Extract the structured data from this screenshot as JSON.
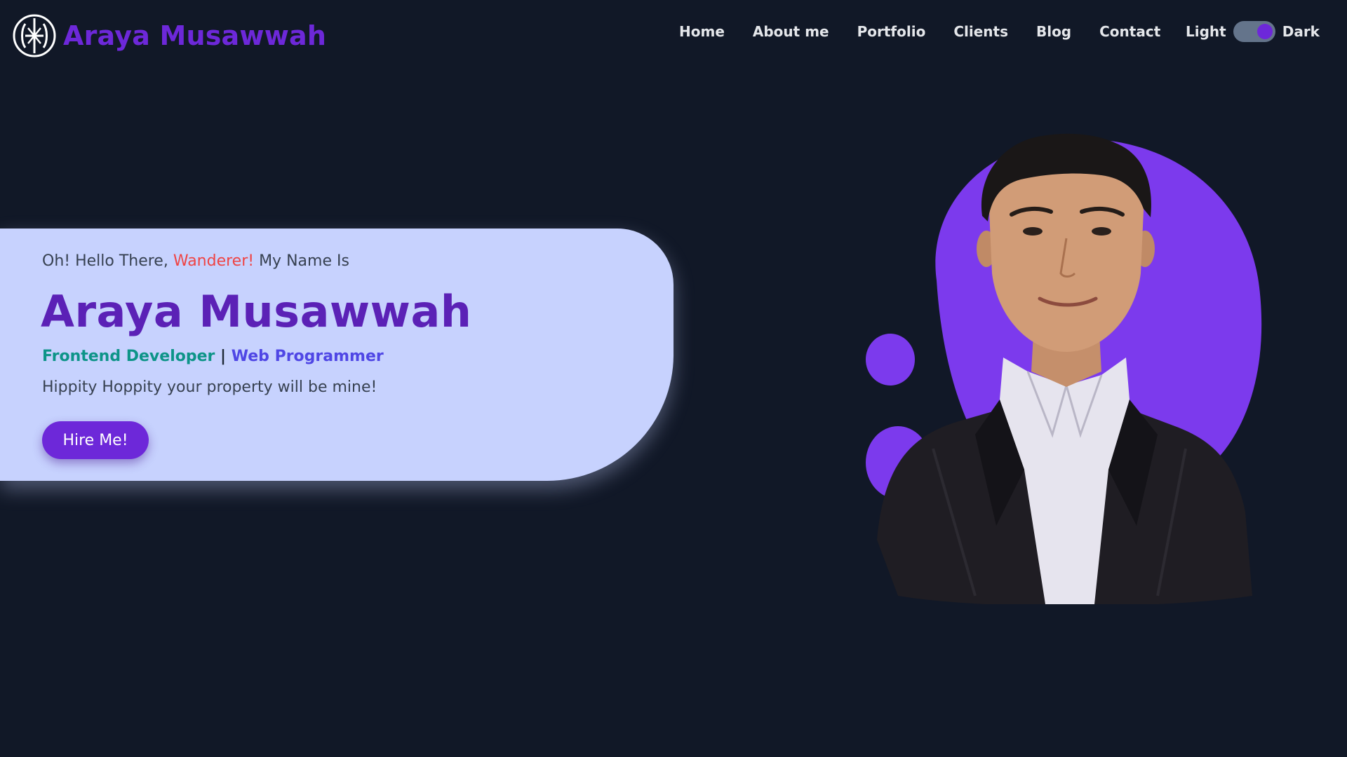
{
  "brand": {
    "logo_icon": "monogram-logo-icon",
    "name": "Araya Musawwah",
    "color": "#6d28d9"
  },
  "nav": {
    "links": [
      {
        "label": "Home"
      },
      {
        "label": "About me"
      },
      {
        "label": "Portfolio"
      },
      {
        "label": "Clients"
      },
      {
        "label": "Blog"
      },
      {
        "label": "Contact"
      }
    ]
  },
  "theme_toggle": {
    "light_label": "Light",
    "dark_label": "Dark",
    "state": "dark"
  },
  "hero": {
    "greeting_prefix": "Oh! Hello There,",
    "greeting_accent": "Wanderer!",
    "greeting_suffix": "My Name Is",
    "name": "Araya Musawwah",
    "role_1": "Frontend Developer",
    "role_separator": "|",
    "role_2": "Web Programmer",
    "tagline": "Hippity Hoppity your property will be mine!",
    "cta_label": "Hire Me!"
  },
  "portrait": {
    "description_icon": "profile-photo",
    "blob_color": "#7c3aed"
  },
  "colors": {
    "background": "#111827",
    "card": "#c7d2fe",
    "accent_red": "#ef4444",
    "teal": "#0d9488",
    "indigo": "#4f46e5",
    "button": "#6d28d9"
  }
}
